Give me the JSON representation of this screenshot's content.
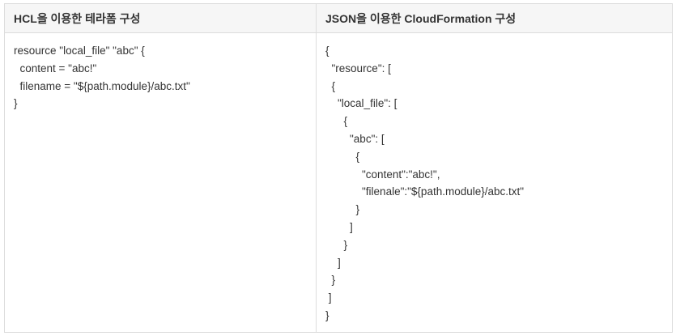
{
  "table": {
    "headers": [
      "HCL을 이용한 테라폼 구성",
      "JSON을 이용한 CloudFormation 구성"
    ],
    "hcl_lines": [
      "resource \"local_file\" \"abc\" {",
      "  content = \"abc!\"",
      "  filename = \"${path.module}/abc.txt\"",
      "}"
    ],
    "json_lines": [
      "{",
      "  \"resource\": [",
      "  {",
      "    \"local_file\": [",
      "      {",
      "        \"abc\": [",
      "          {",
      "            \"content\":\"abc!\",",
      "            \"filenale\":\"${path.module}/abc.txt\"",
      "          }",
      "        ]",
      "      }",
      "    ]",
      "  }",
      " ]",
      "}"
    ]
  }
}
